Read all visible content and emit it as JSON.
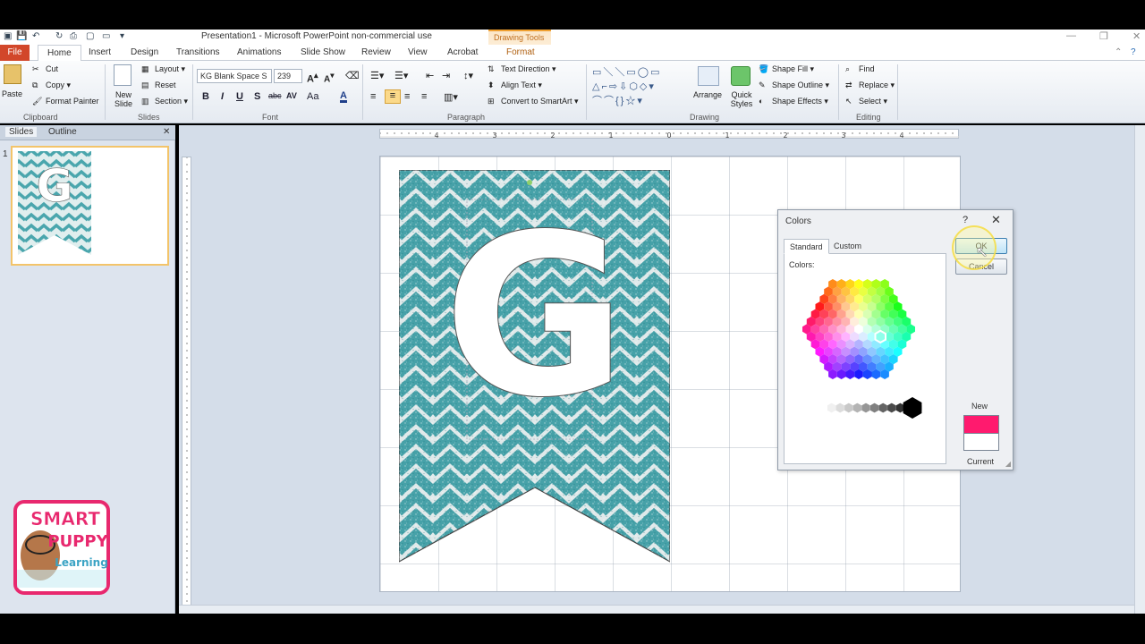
{
  "window": {
    "title": "Presentation1 - Microsoft PowerPoint non-commercial use",
    "contextual_group": "Drawing Tools"
  },
  "tabs": {
    "file": "File",
    "home": "Home",
    "insert": "Insert",
    "design": "Design",
    "transitions": "Transitions",
    "animations": "Animations",
    "slideshow": "Slide Show",
    "review": "Review",
    "view": "View",
    "acrobat": "Acrobat",
    "format": "Format"
  },
  "ribbon": {
    "clipboard": {
      "paste": "Paste",
      "cut": "Cut",
      "copy": "Copy",
      "format_painter": "Format Painter",
      "label": "Clipboard"
    },
    "slides": {
      "new_slide": "New Slide",
      "layout": "Layout",
      "reset": "Reset",
      "section": "Section",
      "label": "Slides"
    },
    "font": {
      "family": "KG Blank Space S",
      "size": "239",
      "bold": "B",
      "italic": "I",
      "underline": "U",
      "shadow": "S",
      "strike": "abc",
      "spacing": "AV",
      "case": "Aa",
      "color": "A",
      "label": "Font"
    },
    "paragraph": {
      "text_direction": "Text Direction",
      "align_text": "Align Text",
      "smartart": "Convert to SmartArt",
      "label": "Paragraph"
    },
    "drawing": {
      "arrange": "Arrange",
      "quick_styles": "Quick Styles",
      "shape_fill": "Shape Fill",
      "shape_outline": "Shape Outline",
      "shape_effects": "Shape Effects",
      "label": "Drawing"
    },
    "editing": {
      "find": "Find",
      "replace": "Replace",
      "select": "Select",
      "label": "Editing"
    }
  },
  "panel": {
    "slides_tab": "Slides",
    "outline_tab": "Outline",
    "slide_number": "1",
    "thumb_letter": "G"
  },
  "ruler": {
    "h_labels": [
      "4",
      "3",
      "2",
      "1",
      "0",
      "1",
      "2",
      "3",
      "4"
    ]
  },
  "slide": {
    "letter": "G"
  },
  "dialog": {
    "title": "Colors",
    "help": "?",
    "close": "✕",
    "tab_standard": "Standard",
    "tab_custom": "Custom",
    "colors_label": "Colors:",
    "ok": "OK",
    "cancel": "Cancel",
    "new_label": "New",
    "current_label": "Current",
    "new_color": "#ff1a6e",
    "current_color": "#ffffff"
  },
  "logo": {
    "line1": "SMART",
    "line2": "PUPPY",
    "line3": "Learning"
  },
  "colors": {
    "banner_teal": "#4aa6ad",
    "file_tab": "#d2472a",
    "logo_pink": "#e8286e"
  }
}
